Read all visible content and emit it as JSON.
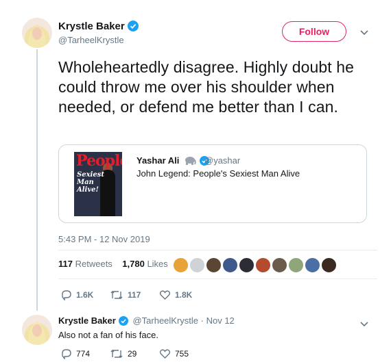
{
  "main_tweet": {
    "author_name": "Krystle Baker",
    "author_handle": "@TarheelKrystle",
    "follow_label": "Follow",
    "text": "Wholeheartedly disagree. Highly doubt he could throw me over his shoulder when needed, or defend me better than I can.",
    "timestamp": "5:43 PM - 12 Nov 2019",
    "retweets_count": "117",
    "retweets_label": "Retweets",
    "likes_count": "1,780",
    "likes_label": "Likes",
    "actions": {
      "replies": "1.6K",
      "retweets": "117",
      "likes": "1.8K"
    }
  },
  "quoted_tweet": {
    "author_name": "Yashar Ali",
    "author_handle": "@yashar",
    "text": "John Legend: People's Sexiest Man Alive",
    "thumbnail": {
      "logo": "People",
      "cover_lines": [
        "Sexiest",
        "Man",
        "Alive!"
      ]
    }
  },
  "reply_tweet": {
    "author_name": "Krystle Baker",
    "author_handle": "@TarheelKrystle",
    "date": "· Nov 12",
    "text": "Also not a fan of his face.",
    "actions": {
      "replies": "774",
      "retweets": "29",
      "likes": "755"
    }
  },
  "colors": {
    "accent_pink": "#e0245e",
    "verified_blue": "#1da1f2",
    "muted_text": "#657786",
    "border": "#ccd6dd"
  },
  "icons": [
    "verified-badge-icon",
    "chevron-down-icon",
    "reply-icon",
    "retweet-icon",
    "like-icon",
    "elephant-icon"
  ]
}
